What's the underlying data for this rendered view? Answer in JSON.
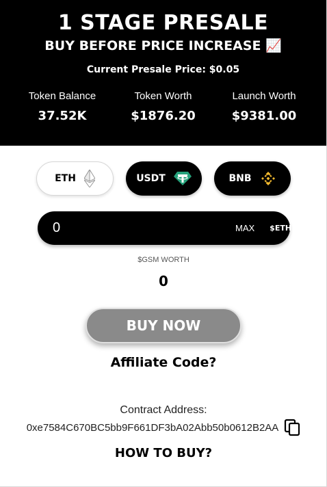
{
  "header": {
    "title": "1 STAGE PRESALE",
    "subtitle": "BUY BEFORE PRICE INCREASE 📈",
    "price_text": "Current Presale Price: $0.05"
  },
  "stats": [
    {
      "label": "Token Balance",
      "value": "37.52K"
    },
    {
      "label": "Token Worth",
      "value": "$1876.20"
    },
    {
      "label": "Launch Worth",
      "value": "$9381.00"
    }
  ],
  "currencies": {
    "eth": {
      "label": "ETH",
      "icon": "ethereum-icon"
    },
    "usdt": {
      "label": "USDT",
      "icon": "tether-icon"
    },
    "bnb": {
      "label": "BNB",
      "icon": "binance-icon"
    }
  },
  "amount_input": {
    "value": "0",
    "max_label": "MAX",
    "unit": "$ETH"
  },
  "worth": {
    "label": "$GSM WORTH",
    "value": "0"
  },
  "buy_button": "BUY NOW",
  "affiliate_link": "Affiliate Code?",
  "contract": {
    "label": "Contract Address:",
    "address": "0xe7584C670BC5bb9F661DF3bA02Abb50b0612B2AA",
    "copy_icon": "copy-icon"
  },
  "howto_link": "HOW TO BUY?",
  "colors": {
    "header_bg": "#000000",
    "buy_button_bg": "#8a8a8a",
    "bnb_yellow": "#f3ba2f",
    "usdt_green": "#26a17b"
  }
}
